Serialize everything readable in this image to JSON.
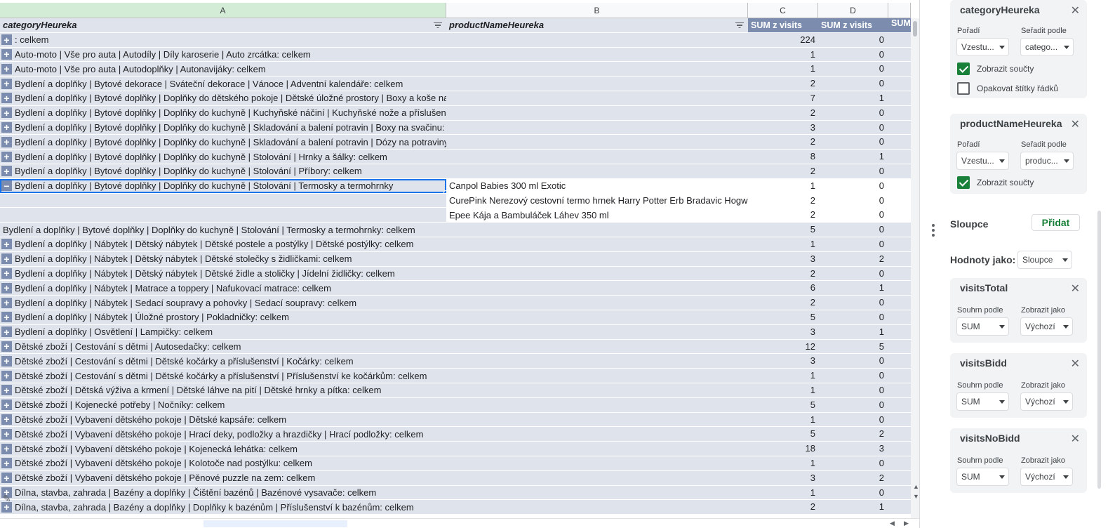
{
  "columns": {
    "a": "A",
    "b": "B",
    "c": "C",
    "d": "D"
  },
  "header_row": {
    "col_a": "categoryHeureka",
    "col_b": "productNameHeureka",
    "col_c": "SUM z visits",
    "col_d": "SUM z visits",
    "col_e": "SUM"
  },
  "rows": [
    {
      "type": "g",
      "expander": "+",
      "a": ": celkem",
      "c": "224",
      "d": "0"
    },
    {
      "type": "g",
      "expander": "+",
      "a": "Auto-moto | Vše pro auta | Autodíly | Díly karoserie | Auto zrcátka: celkem",
      "c": "1",
      "d": "0"
    },
    {
      "type": "g",
      "expander": "+",
      "a": "Auto-moto | Vše pro auta | Autodoplňky | Autonavijáky: celkem",
      "c": "1",
      "d": "0"
    },
    {
      "type": "g",
      "expander": "+",
      "a": "Bydlení a doplňky | Bytové dekorace | Sváteční dekorace | Vánoce | Adventní kalendáře: celkem",
      "c": "2",
      "d": "0"
    },
    {
      "type": "g",
      "expander": "+",
      "a": "Bydlení a doplňky | Bytové doplňky | Doplňky do dětského pokoje | Dětské úložné prostory | Boxy a koše na hračky: celkem",
      "c": "7",
      "d": "1"
    },
    {
      "type": "g",
      "expander": "+",
      "a": "Bydlení a doplňky | Bytové doplňky | Doplňky do kuchyně | Kuchyňské náčiní | Kuchyňské nože a příslušenství | Bloky na nože: celkem",
      "c": "2",
      "d": "0"
    },
    {
      "type": "g",
      "expander": "+",
      "a": "Bydlení a doplňky | Bytové doplňky | Doplňky do kuchyně | Skladování a balení potravin | Boxy na svačinu: celkem",
      "c": "3",
      "d": "0"
    },
    {
      "type": "g",
      "expander": "+",
      "a": "Bydlení a doplňky | Bytové doplňky | Doplňky do kuchyně | Skladování a balení potravin | Dózy na potraviny: celkem",
      "c": "2",
      "d": "0"
    },
    {
      "type": "g",
      "expander": "+",
      "a": "Bydlení a doplňky | Bytové doplňky | Doplňky do kuchyně | Stolování | Hrnky a šálky: celkem",
      "c": "8",
      "d": "1"
    },
    {
      "type": "g",
      "expander": "+",
      "a": "Bydlení a doplňky | Bytové doplňky | Doplňky do kuchyně | Stolování | Příbory: celkem",
      "c": "2",
      "d": "0"
    },
    {
      "type": "w",
      "expander": "−",
      "selected": true,
      "a": "Bydlení a doplňky | Bytové doplňky | Doplňky do kuchyně | Stolování | Termosky a termohrnky",
      "b": "Canpol Babies 300 ml Exotic",
      "c": "1",
      "d": "0"
    },
    {
      "type": "w",
      "a": "",
      "b": "CurePink Nerezový cestovní termo hrnek Harry Potter Erb Bradavic Hogwarts",
      "c": "2",
      "d": "0"
    },
    {
      "type": "w",
      "a": "",
      "b": "Epee Kája a Bambuláček Láhev 350 ml",
      "c": "2",
      "d": "0"
    },
    {
      "type": "g",
      "a": "Bydlení a doplňky | Bytové doplňky | Doplňky do kuchyně | Stolování | Termosky a termohrnky: celkem",
      "c": "5",
      "d": "0"
    },
    {
      "type": "g",
      "expander": "+",
      "a": "Bydlení a doplňky | Nábytek | Dětský nábytek | Dětské postele a postýlky | Dětské postýlky: celkem",
      "c": "1",
      "d": "0"
    },
    {
      "type": "g",
      "expander": "+",
      "a": "Bydlení a doplňky | Nábytek | Dětský nábytek | Dětské stolečky s židličkami: celkem",
      "c": "3",
      "d": "2"
    },
    {
      "type": "g",
      "expander": "+",
      "a": "Bydlení a doplňky | Nábytek | Dětský nábytek | Dětské židle a stoličky | Jídelní židličky: celkem",
      "c": "2",
      "d": "0"
    },
    {
      "type": "g",
      "expander": "+",
      "a": "Bydlení a doplňky | Nábytek | Matrace a toppery | Nafukovací matrace: celkem",
      "c": "6",
      "d": "1"
    },
    {
      "type": "g",
      "expander": "+",
      "a": "Bydlení a doplňky | Nábytek | Sedací soupravy a pohovky | Sedací soupravy: celkem",
      "c": "2",
      "d": "0"
    },
    {
      "type": "g",
      "expander": "+",
      "a": "Bydlení a doplňky | Nábytek | Úložné prostory | Pokladničky: celkem",
      "c": "5",
      "d": "0"
    },
    {
      "type": "g",
      "expander": "+",
      "a": "Bydlení a doplňky | Osvětlení | Lampičky: celkem",
      "c": "3",
      "d": "1"
    },
    {
      "type": "g",
      "expander": "+",
      "a": "Dětské zboží | Cestování s dětmi  | Autosedačky: celkem",
      "c": "12",
      "d": "5"
    },
    {
      "type": "g",
      "expander": "+",
      "a": "Dětské zboží | Cestování s dětmi  | Dětské kočárky a příslušenství | Kočárky: celkem",
      "c": "3",
      "d": "0"
    },
    {
      "type": "g",
      "expander": "+",
      "a": "Dětské zboží | Cestování s dětmi  | Dětské kočárky a příslušenství | Příslušenství ke kočárkům: celkem",
      "c": "1",
      "d": "0"
    },
    {
      "type": "g",
      "expander": "+",
      "a": "Dětské zboží | Dětská výživa a krmení | Dětské  láhve na pití | Dětské hrnky a pítka: celkem",
      "c": "1",
      "d": "0"
    },
    {
      "type": "g",
      "expander": "+",
      "a": "Dětské zboží | Kojenecké potřeby | Nočníky: celkem",
      "c": "5",
      "d": "0"
    },
    {
      "type": "g",
      "expander": "+",
      "a": "Dětské zboží | Vybavení dětského pokoje  | Dětské kapsáře: celkem",
      "c": "1",
      "d": "0"
    },
    {
      "type": "g",
      "expander": "+",
      "a": "Dětské zboží | Vybavení dětského pokoje  | Hrací deky, podložky a hrazdičky | Hrací podložky: celkem",
      "c": "5",
      "d": "2"
    },
    {
      "type": "g",
      "expander": "+",
      "a": "Dětské zboží | Vybavení dětského pokoje  | Kojenecká lehátka: celkem",
      "c": "18",
      "d": "3"
    },
    {
      "type": "g",
      "expander": "+",
      "a": "Dětské zboží | Vybavení dětského pokoje  | Kolotoče nad postýlku: celkem",
      "c": "1",
      "d": "0"
    },
    {
      "type": "g",
      "expander": "+",
      "a": "Dětské zboží | Vybavení dětského pokoje  | Pěnové puzzle na zem: celkem",
      "c": "3",
      "d": "2"
    },
    {
      "type": "g",
      "expander": "+",
      "a": "Dílna, stavba, zahrada | Bazény a doplňky | Čištění bazénů | Bazénové vysavače: celkem",
      "c": "1",
      "d": "0"
    },
    {
      "type": "g",
      "expander": "+",
      "a": "Dílna, stavba, zahrada | Bazény a doplňky | Doplňky k bazénům | Příslušenství k bazénům: celkem",
      "c": "2",
      "d": "1"
    }
  ],
  "panel": {
    "rows_cards": [
      {
        "title": "categoryHeureka",
        "order_label": "Pořadí",
        "order_value": "Vzestu...",
        "sort_label": "Seřadit podle",
        "sort_value": "catego...",
        "show_totals": "Zobrazit součty",
        "repeat_labels": "Opakovat štítky řádků"
      },
      {
        "title": "productNameHeureka",
        "order_label": "Pořadí",
        "order_value": "Vzestu...",
        "sort_label": "Seřadit podle",
        "sort_value": "produc...",
        "show_totals": "Zobrazit součty"
      }
    ],
    "columns_label": "Sloupce",
    "add_button": "Přidat",
    "values_as_label": "Hodnoty jako:",
    "values_as_value": "Sloupce",
    "value_cards": [
      {
        "title": "visitsTotal",
        "summarize_label": "Souhrn podle",
        "summarize_value": "SUM",
        "display_label": "Zobrazit jako",
        "display_value": "Výchozí"
      },
      {
        "title": "visitsBidd",
        "summarize_label": "Souhrn podle",
        "summarize_value": "SUM",
        "display_label": "Zobrazit jako",
        "display_value": "Výchozí"
      },
      {
        "title": "visitsNoBidd",
        "summarize_label": "Souhrn podle",
        "summarize_value": "SUM",
        "display_label": "Zobrazit jako",
        "display_value": "Výchozí"
      }
    ]
  }
}
